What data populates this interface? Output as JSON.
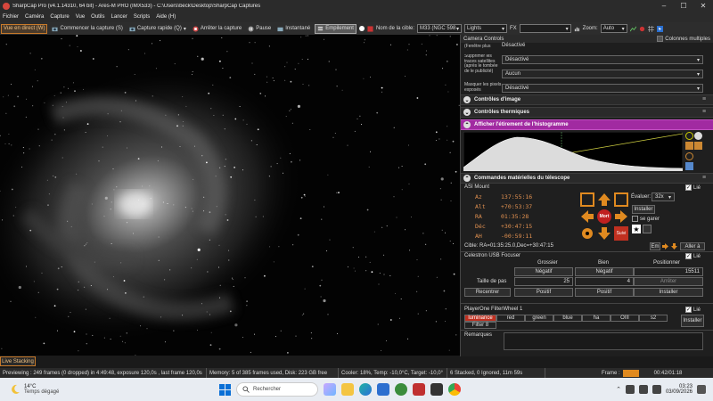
{
  "window": {
    "title": "SharpCap Pro (v4.1.14310, 64 bit) - Ares-M PRO (IMX533) - C:\\Users\\beck\\Desktop\\SharpCap Captures"
  },
  "menu": [
    "Fichier",
    "Caméra",
    "Capture",
    "Vue",
    "Outils",
    "Lancer",
    "Scripts",
    "Aide (H)"
  ],
  "toolbar": {
    "live_view": "Vue en direct (W)",
    "start_capture": "Commencer la capture (S)",
    "quick_capture": "Capture rapide (Q)",
    "stop_capture": "Arrêter la capture",
    "pause": "Pause",
    "snapshot": "Instantané",
    "stacking": "Empilement",
    "target_label": "Nom de la cible:",
    "target_value": "M33 (NGC 598",
    "frame_type": "Lights",
    "fx_label": "FX",
    "zoom_label": "Zoom:",
    "zoom_value": "Auto"
  },
  "panel": {
    "header": "Camera Controls",
    "columns_label": "Colonnes multiples",
    "camera_rows": [
      {
        "label": "(Fenêtre plus",
        "value": "Désactivé"
      },
      {
        "label": "Supprimer les traces satellites (après le tombée de le publicité)",
        "value": "Désactivé"
      },
      {
        "label": "",
        "value": "Aucun"
      },
      {
        "label": "Masquer les pixels exposés",
        "value": "Désactivé"
      }
    ],
    "sections": {
      "image_controls": "Contrôles d'image",
      "thermal_controls": "Contrôles thermiques",
      "histogram": "Afficher l'étirement de l'histogramme",
      "telescope": "Commandes matérielles du télescope"
    },
    "mount": {
      "name": "ASI Mount",
      "linked": "Lié",
      "coords": [
        {
          "label": "Az",
          "value": "137:55:16"
        },
        {
          "label": "Alt",
          "value": "+70:53:37"
        },
        {
          "label": "RA",
          "value": "01:35:28"
        },
        {
          "label": "Déc",
          "value": "+30:47:15"
        },
        {
          "label": "AH",
          "value": "-00:59:11"
        }
      ],
      "center_label": "Mort",
      "slow_label": "Suivi",
      "evaluate_label": "Évaluer:",
      "evaluate_value": "32x",
      "install_label": "Installer",
      "park_label": "se garer",
      "target": "Cible:   RA=01:35:25.0,Dec=+30:47:15",
      "en_label": "Em",
      "goto_label": "Aller à"
    },
    "focuser": {
      "name": "Celestron USB Focuser",
      "linked": "Lié",
      "coarse": "Grossier",
      "fine": "Bien",
      "position": "Positionner",
      "negative": "Négatif",
      "negative2": "Négatif",
      "position_value": "15511",
      "step_label": "Taille de pas",
      "step_coarse": "25",
      "step_fine": "4",
      "stop": "Arrêter",
      "calibrate": "Recentrer",
      "positive": "Positif",
      "positive2": "Positif",
      "install": "Installer"
    },
    "filterwheel": {
      "name": "PlayerOne FilterWheel 1",
      "linked": "Lié",
      "filters": [
        "luminance",
        "red",
        "green",
        "blue",
        "ha",
        "OIII",
        "s2"
      ],
      "filter8": "Filter 8",
      "install": "Installer"
    },
    "remarks_label": "Remarques"
  },
  "live_stacking": "Live Stacking",
  "status": {
    "preview": "Previewing : 249 frames (0 dropped) in 4:49:48, exposure 120,0s , last frame 120,0s",
    "memory": "Memory: 5 of 385 frames used, Disk: 223 GB free",
    "cooler": "Cooler: 18%, Temp: -10,0°C, Target: -10,0°",
    "stacked": "6 Stacked, 0 Ignored, 11m 59s",
    "frame_label": "Frame :",
    "elapsed": "00:42/01:18"
  },
  "taskbar": {
    "weather_temp": "14°C",
    "weather_desc": "Temps dégagé",
    "search": "Rechercher",
    "time": "03:23",
    "date": "03/09/2026"
  },
  "colors": {
    "accent": "#c87a2a",
    "histogram_bar": "#b030b0"
  }
}
